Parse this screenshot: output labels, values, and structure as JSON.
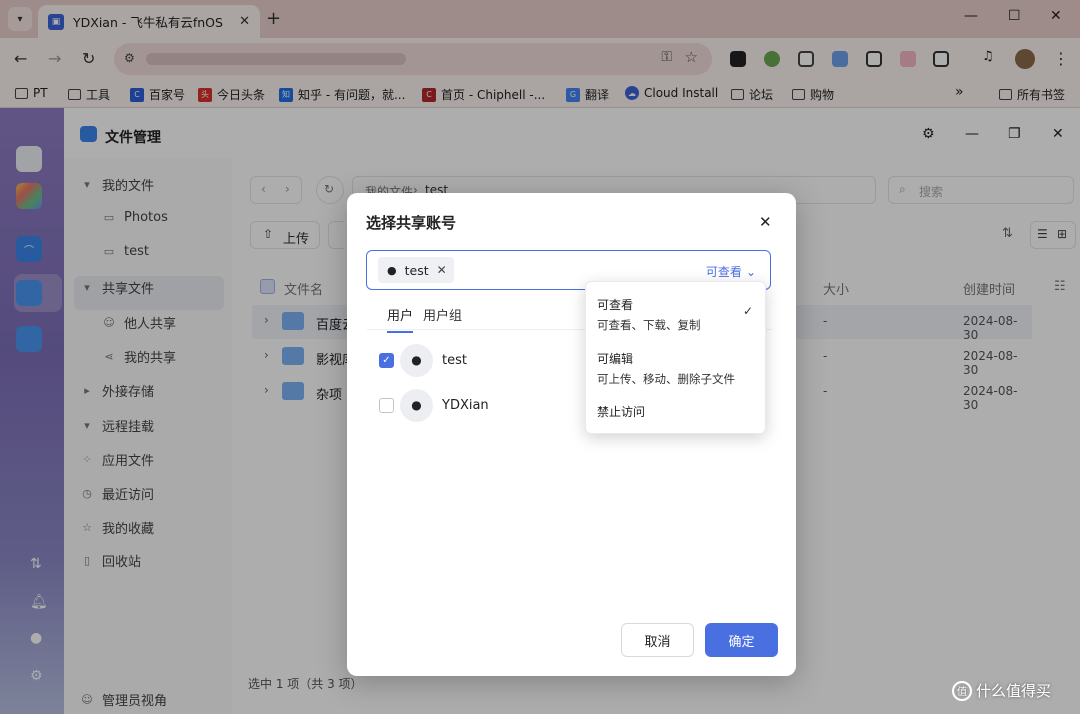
{
  "browser": {
    "tab_title": "YDXian - 飞牛私有云fnOS",
    "new_tab": "+",
    "bookmarks": [
      {
        "label": "PT"
      },
      {
        "label": "工具"
      },
      {
        "label": "百家号"
      },
      {
        "label": "今日头条"
      },
      {
        "label": "知乎 - 有问题，就..."
      },
      {
        "label": "首页 - Chiphell -..."
      },
      {
        "label": "翻译"
      },
      {
        "label": "Cloud Install"
      },
      {
        "label": "论坛"
      },
      {
        "label": "购物"
      }
    ],
    "overflow": "»",
    "all_bookmarks": "所有书签"
  },
  "window": {
    "title": "文件管理"
  },
  "sidebar": {
    "items": [
      {
        "label": "我的文件"
      },
      {
        "label": "Photos"
      },
      {
        "label": "test"
      },
      {
        "label": "共享文件"
      },
      {
        "label": "他人共享"
      },
      {
        "label": "我的共享"
      },
      {
        "label": "外接存储"
      },
      {
        "label": "远程挂载"
      },
      {
        "label": "应用文件"
      },
      {
        "label": "最近访问"
      },
      {
        "label": "我的收藏"
      },
      {
        "label": "回收站"
      }
    ],
    "admin_view": "管理员视角"
  },
  "main": {
    "breadcrumb_root": "我的文件",
    "breadcrumb_sep": "›",
    "breadcrumb_current": "test",
    "search_placeholder": "搜索",
    "upload": "上传",
    "columns": {
      "name": "文件名",
      "size": "大小",
      "created": "创建时间"
    },
    "rows": [
      {
        "name": "百度云",
        "size": "-",
        "created": "2024-08-30"
      },
      {
        "name": "影视库",
        "size": "-",
        "created": "2024-08-30"
      },
      {
        "name": "杂项",
        "size": "-",
        "created": "2024-08-30"
      }
    ],
    "status": "选中 1 项（共 3 项）"
  },
  "dialog": {
    "title": "选择共享账号",
    "chip_label": "test",
    "permission_selected": "可查看",
    "tabs": [
      "用户",
      "用户组"
    ],
    "users": [
      {
        "name": "test",
        "checked": true
      },
      {
        "name": "YDXian",
        "checked": false
      }
    ],
    "cancel": "取消",
    "confirm": "确定"
  },
  "permission_menu": {
    "options": [
      {
        "title": "可查看",
        "desc": "可查看、下载、复制",
        "selected": true
      },
      {
        "title": "可编辑",
        "desc": "可上传、移动、删除子文件",
        "selected": false
      },
      {
        "title": "禁止访问",
        "desc": "",
        "selected": false
      }
    ]
  },
  "watermark": "什么值得买",
  "colors": {
    "accent": "#4a6fe0",
    "chrome_bg": "#e9cfcc",
    "dock_top": "#8e7dc3"
  }
}
